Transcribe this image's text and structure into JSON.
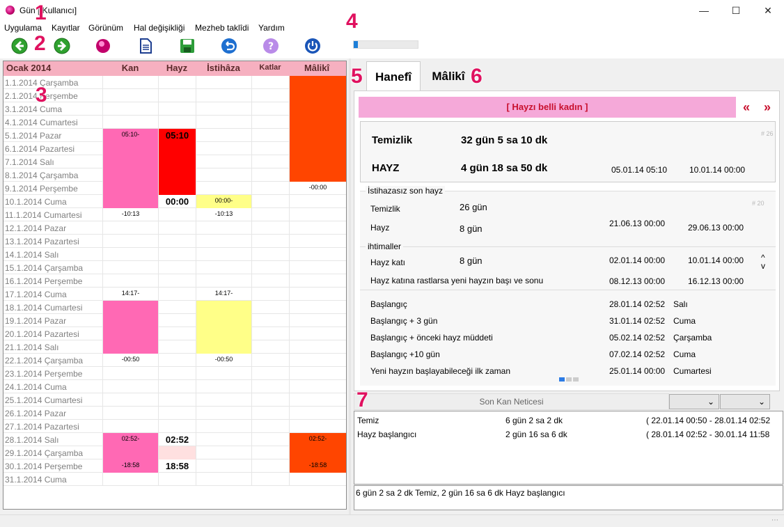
{
  "window": {
    "title": "Gün [ Kullanıcı]"
  },
  "menu": [
    "Uygulama",
    "Kayıtlar",
    "Görünüm",
    "Hal değişikliği",
    "Mezheb taklîdi",
    "Yardım"
  ],
  "toolbar": {
    "icons": [
      "back-icon",
      "forward-icon",
      "logo-icon",
      "document-icon",
      "save-icon",
      "undo-icon",
      "help-icon",
      "power-icon"
    ],
    "progress_fraction": 0.06
  },
  "markers": [
    "1",
    "2",
    "3",
    "4",
    "5",
    "6",
    "7"
  ],
  "colors": {
    "kan": "#ff69b4",
    "hayz": "#ff0000",
    "hayz_light": "#ffe0e0",
    "istihaze": "#ffff88",
    "maliki": "#ff4500",
    "header": "#f6b0c0"
  },
  "calendar": {
    "headers": [
      "Ocak 2014",
      "Kan",
      "Hayz",
      "İstihâza",
      "Katlar",
      "Mâlikî"
    ],
    "rows": [
      {
        "date": "1.1.2014 Çarşamba"
      },
      {
        "date": "2.1.2014 Perşembe"
      },
      {
        "date": "3.1.2014 Cuma"
      },
      {
        "date": "4.1.2014 Cumartesi"
      },
      {
        "date": "5.1.2014 Pazar"
      },
      {
        "date": "6.1.2014 Pazartesi"
      },
      {
        "date": "7.1.2014 Salı"
      },
      {
        "date": "8.1.2014 Çarşamba"
      },
      {
        "date": "9.1.2014 Perşembe"
      },
      {
        "date": "10.1.2014 Cuma"
      },
      {
        "date": "11.1.2014 Cumartesi"
      },
      {
        "date": "12.1.2014 Pazar"
      },
      {
        "date": "13.1.2014 Pazartesi"
      },
      {
        "date": "14.1.2014 Salı"
      },
      {
        "date": "15.1.2014 Çarşamba"
      },
      {
        "date": "16.1.2014 Perşembe"
      },
      {
        "date": "17.1.2014 Cuma"
      },
      {
        "date": "18.1.2014 Cumartesi"
      },
      {
        "date": "19.1.2014 Pazar"
      },
      {
        "date": "20.1.2014 Pazartesi"
      },
      {
        "date": "21.1.2014 Salı"
      },
      {
        "date": "22.1.2014 Çarşamba"
      },
      {
        "date": "23.1.2014 Perşembe"
      },
      {
        "date": "24.1.2014 Cuma"
      },
      {
        "date": "25.1.2014 Cumartesi"
      },
      {
        "date": "26.1.2014 Pazar"
      },
      {
        "date": "27.1.2014 Pazartesi"
      },
      {
        "date": "28.1.2014 Salı"
      },
      {
        "date": "29.1.2014 Çarşamba"
      },
      {
        "date": "30.1.2014 Perşembe"
      },
      {
        "date": "31.1.2014 Cuma"
      }
    ],
    "cells": [
      {
        "row": 0,
        "col": "maliki",
        "fill": "maliki"
      },
      {
        "row": 1,
        "col": "maliki",
        "fill": "maliki"
      },
      {
        "row": 2,
        "col": "maliki",
        "fill": "maliki"
      },
      {
        "row": 3,
        "col": "maliki",
        "fill": "maliki"
      },
      {
        "row": 4,
        "col": "maliki",
        "fill": "maliki"
      },
      {
        "row": 5,
        "col": "maliki",
        "fill": "maliki"
      },
      {
        "row": 6,
        "col": "maliki",
        "fill": "maliki"
      },
      {
        "row": 7,
        "col": "maliki",
        "fill": "maliki"
      },
      {
        "row": 8,
        "col": "maliki",
        "text": "-00:00"
      },
      {
        "row": 4,
        "col": "kan",
        "fill": "kan",
        "text": "05:10-"
      },
      {
        "row": 5,
        "col": "kan",
        "fill": "kan"
      },
      {
        "row": 6,
        "col": "kan",
        "fill": "kan"
      },
      {
        "row": 7,
        "col": "kan",
        "fill": "kan"
      },
      {
        "row": 8,
        "col": "kan",
        "fill": "kan"
      },
      {
        "row": 9,
        "col": "kan",
        "fill": "kan"
      },
      {
        "row": 10,
        "col": "kan",
        "text": "-10:13"
      },
      {
        "row": 4,
        "col": "hayz",
        "fill": "hayz",
        "big": "05:10"
      },
      {
        "row": 5,
        "col": "hayz",
        "fill": "hayz"
      },
      {
        "row": 6,
        "col": "hayz",
        "fill": "hayz"
      },
      {
        "row": 7,
        "col": "hayz",
        "fill": "hayz"
      },
      {
        "row": 8,
        "col": "hayz",
        "fill": "hayz"
      },
      {
        "row": 9,
        "col": "hayz",
        "big": "00:00"
      },
      {
        "row": 9,
        "col": "istihaze",
        "fill": "istihaze",
        "text": "00:00-"
      },
      {
        "row": 10,
        "col": "istihaze",
        "text": "-10:13"
      },
      {
        "row": 16,
        "col": "kan",
        "text": "14:17-"
      },
      {
        "row": 17,
        "col": "kan",
        "fill": "kan"
      },
      {
        "row": 18,
        "col": "kan",
        "fill": "kan"
      },
      {
        "row": 19,
        "col": "kan",
        "fill": "kan"
      },
      {
        "row": 20,
        "col": "kan",
        "fill": "kan"
      },
      {
        "row": 21,
        "col": "kan",
        "text": "-00:50"
      },
      {
        "row": 16,
        "col": "istihaze",
        "text": "14:17-"
      },
      {
        "row": 17,
        "col": "istihaze",
        "fill": "istihaze"
      },
      {
        "row": 18,
        "col": "istihaze",
        "fill": "istihaze"
      },
      {
        "row": 19,
        "col": "istihaze",
        "fill": "istihaze"
      },
      {
        "row": 20,
        "col": "istihaze",
        "fill": "istihaze"
      },
      {
        "row": 21,
        "col": "istihaze",
        "text": "-00:50"
      },
      {
        "row": 27,
        "col": "kan",
        "fill": "kan",
        "text": "02:52-"
      },
      {
        "row": 28,
        "col": "kan",
        "fill": "kan"
      },
      {
        "row": 29,
        "col": "kan",
        "fill": "kan",
        "text": "-18:58"
      },
      {
        "row": 27,
        "col": "hayz",
        "big": "02:52"
      },
      {
        "row": 28,
        "col": "hayz",
        "fill": "hayz_light"
      },
      {
        "row": 29,
        "col": "hayz",
        "big": "18:58"
      },
      {
        "row": 27,
        "col": "maliki",
        "fill": "maliki",
        "text": "02:52-"
      },
      {
        "row": 28,
        "col": "maliki",
        "fill": "maliki"
      },
      {
        "row": 29,
        "col": "maliki",
        "fill": "maliki",
        "text": "-18:58"
      }
    ]
  },
  "tabs": [
    "Hanefî",
    "Mâlikî"
  ],
  "hanefi": {
    "banner": "[ Hayzı belli kadın ]",
    "nav_prev": "«",
    "nav_next": "»",
    "summary": {
      "temizlik_label": "Temizlik",
      "temizlik_value": "32 gün  5 sa  10 dk",
      "ref": "# 26",
      "hayz_label": "HAYZ",
      "hayz_value": "4 gün  18 sa  50 dk",
      "hayz_start": "05.01.14  05:10",
      "hayz_end": "10.01.14  00:00"
    },
    "istihazasiz": {
      "title": "İstihazasız son hayz",
      "ref": "# 20",
      "temizlik_label": "Temizlik",
      "temizlik_value": "26 gün",
      "hayz_label": "Hayz",
      "hayz_value": "8 gün",
      "hayz_start": "21.06.13  00:00",
      "hayz_end": "29.06.13  00:00"
    },
    "ihtimaller": {
      "title": "ihtimaller",
      "kat_label": "Hayz katı",
      "kat_value": "8 gün",
      "kat_start": "02.01.14  00:00",
      "kat_end": "10.01.14  00:00",
      "up": "^",
      "down": "v",
      "rast_label": "Hayz katına rastlarsa yeni hayzın başı ve sonu",
      "rast_start": "08.12.13  00:00",
      "rast_end": "16.12.13  00:00"
    },
    "baslangic": [
      {
        "label": "Başlangıç",
        "date": "28.01.14  02:52",
        "day": "Salı"
      },
      {
        "label": "Başlangıç + 3 gün",
        "date": "31.01.14  02:52",
        "day": "Cuma"
      },
      {
        "label": "Başlangıç + önceki hayz müddeti",
        "date": "05.02.14  02:52",
        "day": "Çarşamba"
      },
      {
        "label": "Başlangıç +10 gün",
        "date": "07.02.14  02:52",
        "day": "Cuma"
      },
      {
        "label": "Yeni hayzın başlayabileceği ilk zaman",
        "date": "25.01.14  00:00",
        "day": "Cumartesi"
      }
    ]
  },
  "sonkan": {
    "label": "Son Kan Neticesi",
    "combo1": "",
    "combo2": "",
    "rows": [
      {
        "name": "Temiz",
        "duration": "6 gün  2 sa  2 dk",
        "range": "( 22.01.14  00:50 - 28.01.14  02:52"
      },
      {
        "name": "Hayz başlangıcı",
        "duration": "2 gün  16 sa  6 dk",
        "range": "( 28.01.14  02:52 - 30.01.14  11:58"
      }
    ],
    "summary": "6 gün  2 sa  2 dk Temiz, 2 gün  16 sa  6 dk Hayz başlangıcı"
  }
}
